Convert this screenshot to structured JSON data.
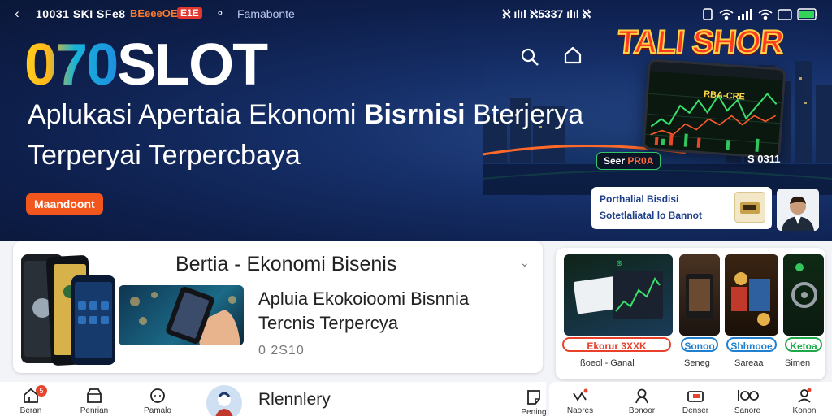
{
  "status_bar": {
    "carrier": "10031 SKI SFe8",
    "badge_orange": "BEeeeOEDD",
    "badge_red": "E1E",
    "app_name": "Famabonte",
    "center": "ℵ  ılıl  ℵ5337  ılıl  ℵ"
  },
  "hero": {
    "logo_digits": "070",
    "logo_word": "SLOT",
    "tagline_normal": "Aplukasi Apertaia Ekonomi ",
    "tagline_bold": "Bisrnisi",
    "tagline_tail": " Bterjerya",
    "tagline_line2": "Terperyai Terpercbaya",
    "cta_chip": "Maandoont",
    "promo_title": "TALI SHOR",
    "pill_prefix": "Seer ",
    "pill_accent": "PR0A",
    "counter": "S 0311",
    "card_line1": "Porthalial Bisdisi",
    "card_line2": "Sotetlaliatal lo Bannot",
    "tablet_label": "RBA-CRE"
  },
  "content": {
    "title": "Bertia - Ekonomi Bisenis",
    "subtitle_line1": "Apluia Ekokoioomi Bisnnia",
    "subtitle_line2": "Tercnis  Terpercya",
    "meta": "0 2S10"
  },
  "tiles": [
    {
      "button": "Ekorur 3XXK",
      "caption": "ßoeol - Ganal",
      "color": "#e8402a"
    },
    {
      "button": "Sonoo",
      "caption": "Seneg",
      "color": "#1f7fd1"
    },
    {
      "button": "Shhnooe",
      "caption": "Sareaa",
      "color": "#1f7fd1"
    },
    {
      "button": "Ketoa",
      "caption": "Simen",
      "color": "#1fa84a"
    }
  ],
  "bottom_nav": {
    "left_items": [
      {
        "label": "Beran",
        "badge": "5",
        "icon": "home-icon"
      },
      {
        "label": "Penrian",
        "icon": "store-icon"
      },
      {
        "label": "Pamalo",
        "icon": "chat-icon"
      }
    ],
    "center_title": "Rlennlery",
    "right_label_left": "Pening",
    "right_items": [
      {
        "label": "Naores",
        "icon": "apps-icon"
      },
      {
        "label": "Bonoor",
        "icon": "user-icon"
      },
      {
        "label": "Denser",
        "icon": "wallet-icon"
      },
      {
        "label": "Sanore",
        "icon": "grid-icon"
      },
      {
        "label": "Konon",
        "icon": "profile-icon"
      }
    ]
  },
  "colors": {
    "hero_bg": "#0e1f4c",
    "accent_orange": "#f2561d",
    "accent_blue": "#1f7fd1",
    "accent_green": "#1fa84a"
  }
}
